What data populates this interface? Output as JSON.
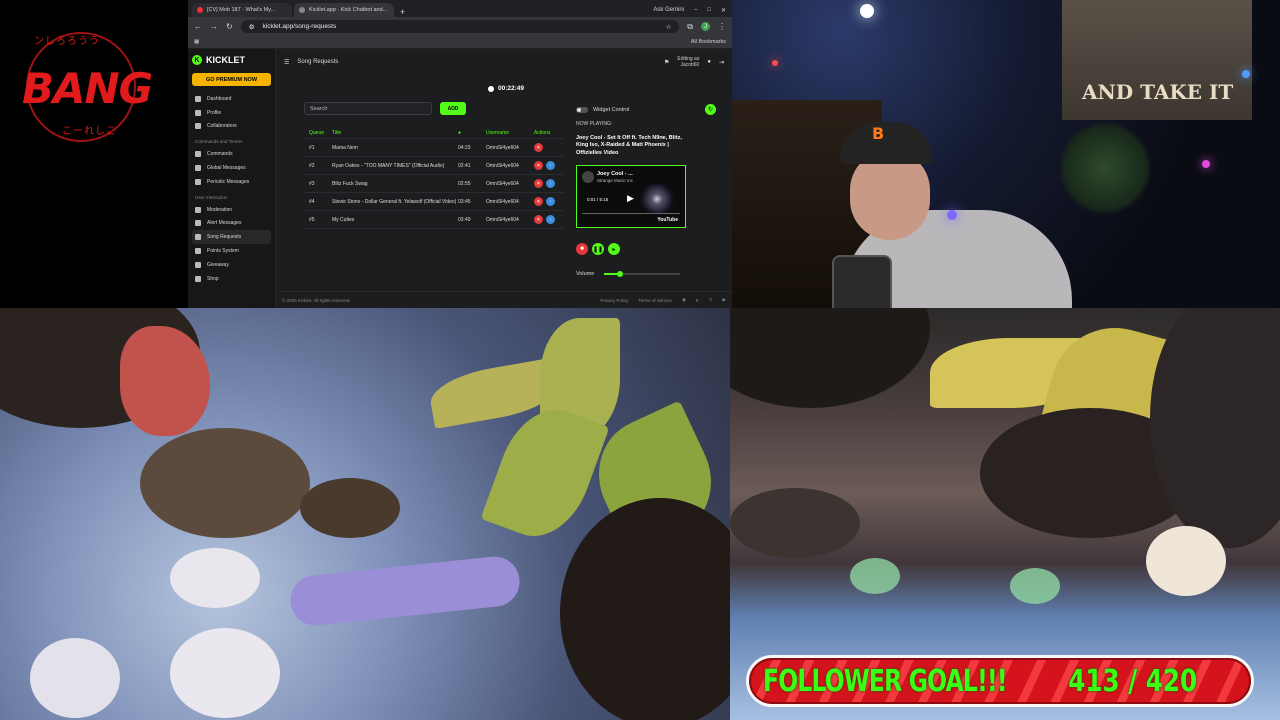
{
  "logo": {
    "text": "BANG",
    "top_glyphs": "ンしろろうう",
    "bottom_glyphs": "こーれしこ"
  },
  "browser": {
    "tabs": [
      {
        "label": "[CV] Mob 187 · What's My..."
      },
      {
        "label": "Kicklet.app · Kick Chatbot and..."
      }
    ],
    "ask_gemini": "Ask Gemini",
    "url": "kicklet.app/song-requests",
    "all_bookmarks": "All Bookmarks"
  },
  "app": {
    "brand": "KICKLET",
    "premium_button": "GO PREMIUM NOW",
    "sidebar_top": [
      {
        "label": "Dashboard"
      },
      {
        "label": "Profile"
      },
      {
        "label": "Collaborators"
      }
    ],
    "section_commands": "Commands and Timers",
    "sidebar_commands": [
      {
        "label": "Commands"
      },
      {
        "label": "Global Messages"
      },
      {
        "label": "Periodic Messages"
      }
    ],
    "section_interaction": "User Interaction",
    "sidebar_interaction": [
      {
        "label": "Moderation"
      },
      {
        "label": "Alert Messages"
      },
      {
        "label": "Song Requests"
      },
      {
        "label": "Points System"
      },
      {
        "label": "Giveaway"
      },
      {
        "label": "Shop"
      }
    ],
    "page_title": "Song Requests",
    "editing_as": "Editing as",
    "editing_user": "Jacob60",
    "timer": "00:22:49",
    "search_placeholder": "Search",
    "add_button": "ADD",
    "table": {
      "headers": {
        "queue": "Queue",
        "title": "Title",
        "duration": "",
        "username": "Username",
        "actions": "Actions"
      },
      "rows": [
        {
          "queue": "#1",
          "title": "Mama Nem",
          "duration": "04:23",
          "username": "OmniSl4ye604"
        },
        {
          "queue": "#2",
          "title": "Ryan Oakes - \"TOO MANY TIMES\" (Official Audio)",
          "duration": "02:41",
          "username": "OmniSl4ye604"
        },
        {
          "queue": "#3",
          "title": "Blitz Fuck Swag",
          "duration": "02:55",
          "username": "OmniSl4ye604"
        },
        {
          "queue": "#4",
          "title": "Stevie Stone - Dollar General ft. Yelawolf (Official Video)",
          "duration": "03:45",
          "username": "OmniSl4ye604"
        },
        {
          "queue": "#5",
          "title": "My Cuties",
          "duration": "03:49",
          "username": "OmniSl4ye604"
        }
      ]
    },
    "widget_control": "Widget Control",
    "now_playing_label": "NOW PLAYING:",
    "now_playing_title": "Joey Cool - Set It Off ft. Tech N9ne, Blitz, King Iso, X-Raided & Matt Phoenix | Offizielles Video",
    "player": {
      "title": "Joey Cool - ...",
      "channel": "Strange Music Inc",
      "time": "0:01 / 5:15",
      "brand": "YouTube"
    },
    "volume_label": "Volume",
    "volume_level": 0.2,
    "footer_copyright": "© 2026 Kicklet. All rights reserved.",
    "footer_privacy": "Privacy Policy",
    "footer_terms": "Terms of Service"
  },
  "webcam": {
    "banner_text": "AND TAKE IT",
    "hat_logo": "B"
  },
  "follower_goal": {
    "label": "FOLLOWER GOAL!!!",
    "count": "413 / 420",
    "current": 413,
    "target": 420
  },
  "colors": {
    "kick_green": "#53fc18",
    "goal_red": "#d5131c",
    "goal_text": "#39ff14",
    "logo_red": "#e11b1b"
  }
}
